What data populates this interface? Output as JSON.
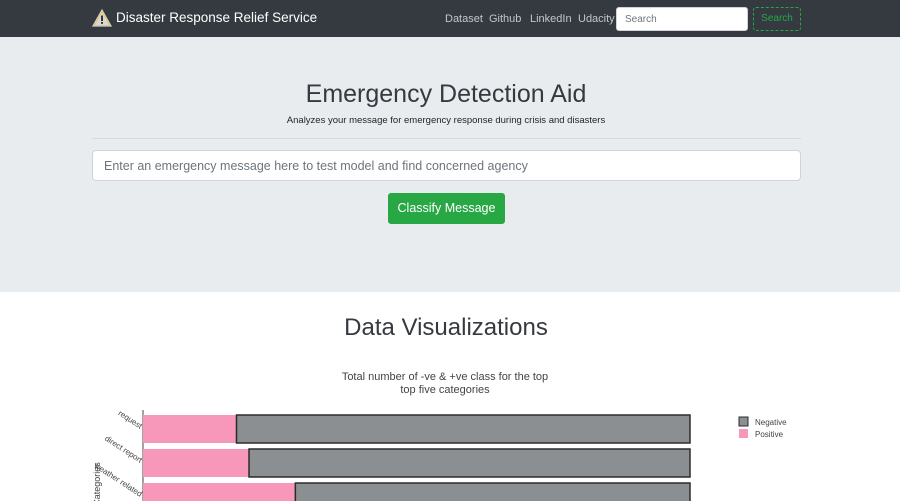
{
  "navbar": {
    "brand": "Disaster Response Relief Service",
    "brand_icon": "warning-icon",
    "links": [
      "Dataset",
      "Github",
      "LinkedIn",
      "Udacity"
    ],
    "search_placeholder": "Search",
    "search_button": "Search"
  },
  "hero": {
    "title": "Emergency Detection Aid",
    "subtitle": "Analyzes your message for emergency response during crisis and disasters",
    "input_placeholder": "Enter an emergency message here to test model and find concerned agency",
    "button_label": "Classify Message"
  },
  "visualizations": {
    "title": "Data Visualizations"
  },
  "chart_data": {
    "type": "bar",
    "orientation": "horizontal",
    "stacked": true,
    "title": "Total number of -ve & +ve class for the top top five categories",
    "title_lines": [
      "Total number of -ve & +ve class for the top",
      "top five categories"
    ],
    "ylabel": "Categories",
    "categories": [
      "request",
      "direct report",
      "weather related"
    ],
    "series": [
      {
        "name": "Positive",
        "color": "#f797b9",
        "values": [
          4480,
          5080,
          7300
        ]
      },
      {
        "name": "Negative",
        "color": "#8c8f91",
        "values": [
          21730,
          21130,
          18910
        ]
      }
    ],
    "legend": {
      "position": "top-right",
      "entries": [
        "Negative",
        "Positive"
      ]
    }
  }
}
